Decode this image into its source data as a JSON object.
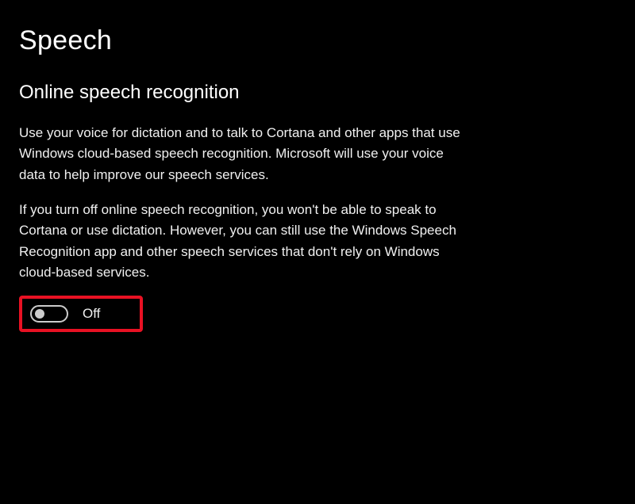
{
  "page": {
    "title": "Speech"
  },
  "section": {
    "title": "Online speech recognition",
    "description1": "Use your voice for dictation and to talk to Cortana and other apps that use Windows cloud-based speech recognition. Microsoft will use your voice data to help improve our speech services.",
    "description2": "If you turn off online speech recognition, you won't be able to speak to Cortana or use dictation. However, you can still use the Windows Speech Recognition app and other speech services that don't rely on Windows cloud-based services."
  },
  "toggle": {
    "state": "off",
    "label": "Off"
  }
}
